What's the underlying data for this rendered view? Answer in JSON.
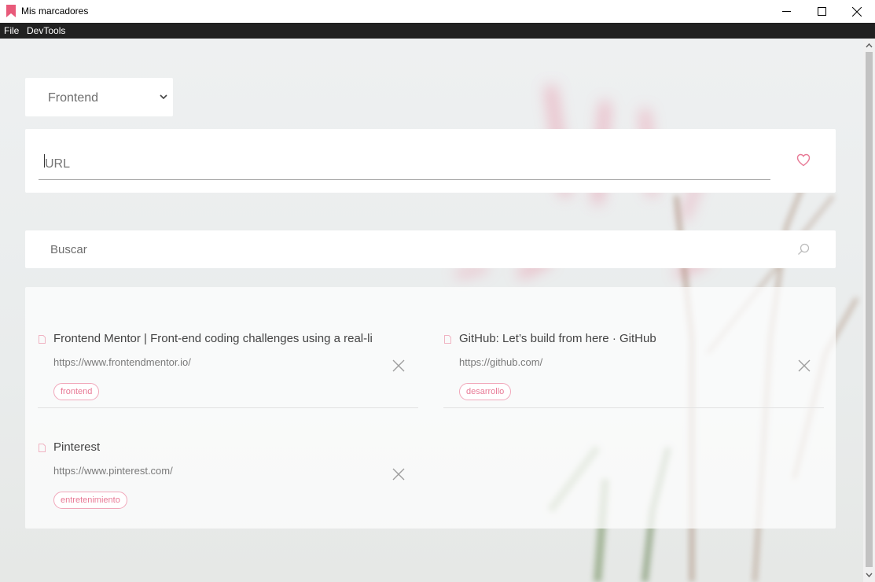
{
  "window": {
    "title": "Mis marcadores",
    "accent": "#e85a7a"
  },
  "menu": {
    "items": [
      "File",
      "DevTools"
    ]
  },
  "category": {
    "selected": "Frontend"
  },
  "url_form": {
    "placeholder": "URL",
    "value": ""
  },
  "search": {
    "placeholder": "Buscar",
    "value": ""
  },
  "bookmarks": [
    {
      "title": "Frontend Mentor | Front-end coding challenges using a real-li",
      "url": "https://www.frontendmentor.io/",
      "tag": "frontend"
    },
    {
      "title": "GitHub: Let’s build from here · GitHub",
      "url": "https://github.com/",
      "tag": "desarrollo"
    },
    {
      "title": "Pinterest",
      "url": "https://www.pinterest.com/",
      "tag": "entretenimiento"
    }
  ],
  "icons": {
    "app": "bookmark-icon",
    "favorite": "heart-icon",
    "search": "search-icon",
    "page": "file-icon",
    "delete": "close-icon"
  }
}
